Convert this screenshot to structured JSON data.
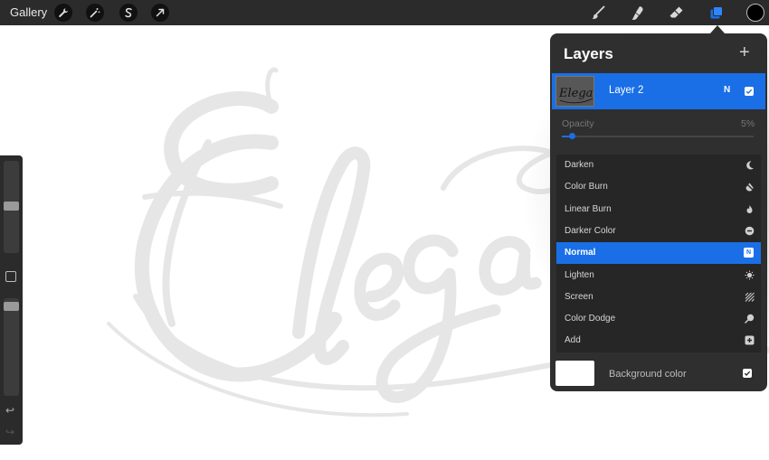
{
  "topbar": {
    "gallery_label": "Gallery",
    "left_tools": [
      "wrench-icon",
      "magic-wand-icon",
      "selection-s-icon",
      "transform-arrow-icon"
    ],
    "right_tools": [
      "brush-icon",
      "smudge-icon",
      "eraser-icon",
      "layers-icon"
    ],
    "active_color": "#000000",
    "accent": "#1a6fe6"
  },
  "canvas": {
    "background": "#ffffff",
    "lettering_color": "#e6e6e6"
  },
  "layers_panel": {
    "title": "Layers",
    "add_icon": "+",
    "layer": {
      "name": "Layer 2",
      "blend_mode_letter": "N",
      "visible": true,
      "thumbnail_text": "Elegant"
    },
    "opacity": {
      "label": "Opacity",
      "value": "5%",
      "fraction": 0.05
    },
    "blend_modes": [
      {
        "label": "Darken",
        "icon": "moon-icon",
        "selected": false
      },
      {
        "label": "Color Burn",
        "icon": "burn-icon",
        "selected": false
      },
      {
        "label": "Linear Burn",
        "icon": "flame-icon",
        "selected": false
      },
      {
        "label": "Darker Color",
        "icon": "minus-circle-icon",
        "selected": false
      },
      {
        "label": "Normal",
        "icon": "n-badge-icon",
        "badge": "N",
        "selected": true
      },
      {
        "label": "Lighten",
        "icon": "sun-icon",
        "selected": false
      },
      {
        "label": "Screen",
        "icon": "hatch-icon",
        "selected": false
      },
      {
        "label": "Color Dodge",
        "icon": "dodge-icon",
        "selected": false
      },
      {
        "label": "Add",
        "icon": "plus-square-icon",
        "selected": false
      }
    ],
    "background_layer": {
      "name": "Background color",
      "color": "#ffffff",
      "visible": true
    }
  },
  "sidebar": {
    "brush_size_level": 0.5,
    "opacity_level": 0.98,
    "undo_glyph": "↩",
    "redo_glyph": "↪"
  }
}
